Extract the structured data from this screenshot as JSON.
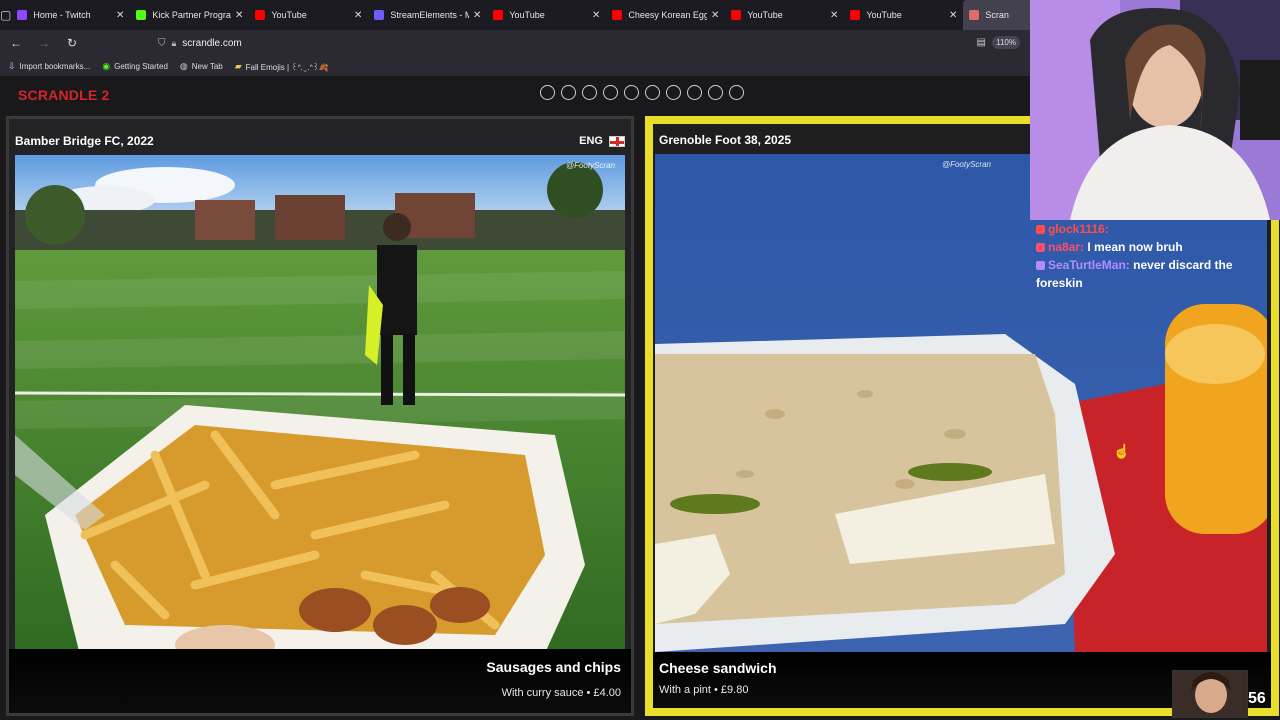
{
  "browser": {
    "tabs": [
      {
        "label": "Home - Twitch",
        "color": "#9146ff"
      },
      {
        "label": "Kick Partner Program -",
        "color": "#53fc18"
      },
      {
        "label": "YouTube",
        "color": "#ff0000"
      },
      {
        "label": "StreamElements - My c",
        "color": "#6d5dfc"
      },
      {
        "label": "YouTube",
        "color": "#ff0000"
      },
      {
        "label": "Cheesy Korean Egg Toa",
        "color": "#ff0000"
      },
      {
        "label": "YouTube",
        "color": "#ff0000"
      },
      {
        "label": "YouTube",
        "color": "#ff0000"
      },
      {
        "label": "Scran",
        "color": "#e06b6b"
      }
    ],
    "url": "scrandle.com",
    "zoom": "110%",
    "bookmarks": [
      {
        "label": "Import bookmarks...",
        "icon": "import-icon"
      },
      {
        "label": "Getting Started",
        "icon": "firefox-icon"
      },
      {
        "label": "New Tab",
        "icon": "globe-icon"
      },
      {
        "label": "Fall Emojis | ꒰ᐢ. ̫ .ᐢ꒱🍂",
        "icon": "folder-icon"
      }
    ]
  },
  "game": {
    "brand": "SCRANDLE 2",
    "progress_dots": 10,
    "left": {
      "club": "Bamber Bridge FC, 2022",
      "country": "ENG",
      "watermark": "@FootyScran",
      "dish": "Sausages and chips",
      "detail": "With curry sauce • £4.00"
    },
    "right": {
      "club": "Grenoble Foot 38, 2025",
      "watermark": "@FootyScran",
      "dish": "Cheese sandwich",
      "detail": "With a pint • £9.80"
    }
  },
  "chat": {
    "messages": [
      {
        "user": "glock1116:",
        "text": "",
        "color": "#ff4d4d"
      },
      {
        "user": "na8ar:",
        "text": "I mean now bruh",
        "color": "#ff4d6d"
      },
      {
        "user": "SeaTurtleMan:",
        "text": "never discard the foreskin",
        "color": "#b38cff"
      }
    ]
  },
  "viewer_count": "56",
  "colors": {
    "brand_red": "#d7242b",
    "selected_border": "#e9df2a"
  }
}
